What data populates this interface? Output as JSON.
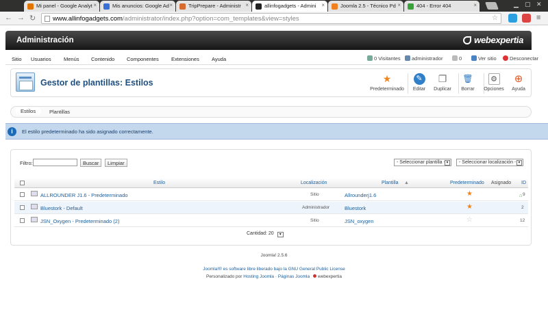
{
  "browser": {
    "tabs": [
      {
        "title": "Mi panel - Google Analyt",
        "color": "#e37400"
      },
      {
        "title": "Mis anuncios: Google Ad",
        "color": "#3b6fd8"
      },
      {
        "title": "TripPrepare - Administr",
        "color": "#d66a2f"
      },
      {
        "title": "allinfogadgets - Admini",
        "color": "#222222"
      },
      {
        "title": "Joomla 2.5 - Técnico Pd",
        "color": "#f08020"
      },
      {
        "title": "404 - Error 404",
        "color": "#3aa23a"
      }
    ],
    "active_tab": 3,
    "close_glyph": "×",
    "url_domain": "www.allinfogadgets.com",
    "url_path": "/administrator/index.php?option=com_templates&view=styles"
  },
  "admin": {
    "title": "Administración",
    "brand": "webexpertia",
    "menu": [
      "Sitio",
      "Usuarios",
      "Menús",
      "Contenido",
      "Componentes",
      "Extensiones",
      "Ayuda"
    ],
    "status": {
      "visitors": "0 Visitantes",
      "admins": "administrador",
      "messages": "0",
      "view_site": "Ver sitio",
      "logout": "Desconectar"
    }
  },
  "page": {
    "title": "Gestor de plantillas: Estilos",
    "toolbar": {
      "default": "Predeterminado",
      "edit": "Editar",
      "duplicate": "Duplicar",
      "delete": "Borrar",
      "options": "Opciones",
      "help": "Ayuda"
    },
    "subtabs": [
      "Estilos",
      "Plantillas"
    ],
    "message": "El estilo predeterminado ha sido asignado correctamente."
  },
  "filters": {
    "label": "Filtro:",
    "search_btn": "Buscar",
    "clear_btn": "Limpiar",
    "select_template": "- Seleccionar plantilla -",
    "select_location": "- Seleccionar localización -"
  },
  "table": {
    "headers": {
      "style": "Estilo",
      "location": "Localización",
      "template": "Plantilla",
      "default": "Predeterminado",
      "assigned": "Asignado",
      "id": "ID"
    },
    "rows": [
      {
        "style": "ALLROUNDER J1.6 - Predeterminado",
        "location": "Sitio",
        "template": "Allrounderj1.6",
        "is_default": true,
        "id": "9"
      },
      {
        "style": "Bluestork - Default",
        "location": "Administrador",
        "template": "Bluestork",
        "is_default": true,
        "id": "2"
      },
      {
        "style": "JSN_Oxygen - Predeterminado (2)",
        "location": "Sitio",
        "template": "JSN_oxygen",
        "is_default": false,
        "id": "12"
      }
    ],
    "pager": "Cantidad: 20"
  },
  "footer": {
    "version": "Joomla! 2.5.6",
    "license_text": "Joomla!® es software libre liberado bajo la",
    "license_link": "GNU General Public License",
    "custom_prefix": "Personalizado por",
    "hosting": "Hosting Joomla",
    "pages": "Páginas Joomla",
    "brand": "webexpertia"
  },
  "icons": {
    "back": "←",
    "forward": "→",
    "reload": "↻",
    "star": "☆",
    "default": "★",
    "edit": "✎",
    "duplicate": "❐",
    "delete": "🗑",
    "options": "⚙",
    "help": "⊕",
    "info": "i",
    "down": "▾"
  },
  "colors": {
    "star_active": "#f0841e",
    "star_inactive": "#c8c8c8",
    "link": "#1c5d99",
    "message_bg": "#c3d7ed"
  }
}
